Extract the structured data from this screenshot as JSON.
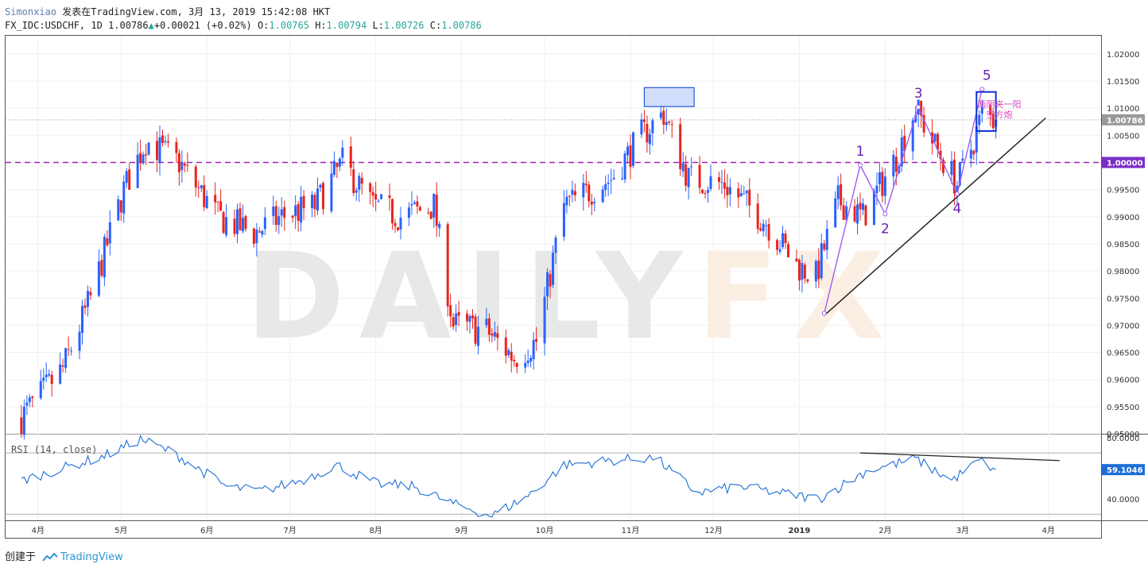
{
  "header": {
    "author": "Simonxiao",
    "published": "发表在TradingView.com, 3月 13, 2019 15:42:08 HKT",
    "symbol": "FX_IDC:USDCHF, 1D",
    "last": "1.00786",
    "change": "+0.00021 (+0.02%)",
    "o_label": "O:",
    "o": "1.00765",
    "h_label": "H:",
    "h": "1.00794",
    "l_label": "L:",
    "l": "1.00726",
    "c_label": "C:",
    "c": "1.00786"
  },
  "footer": {
    "created_by": "创建于",
    "brand": "TradingView"
  },
  "colors": {
    "up": "#2962ff",
    "down": "#e8251d",
    "dashed": "#9c27b0",
    "wave": "#a05cf0",
    "accent": "#26a69a"
  },
  "watermark": "DAILYFX",
  "chart_data": [
    {
      "type": "candlestick",
      "title": "FX_IDC:USDCHF, 1D",
      "x_tick_labels": [
        "4月",
        "5月",
        "6月",
        "7月",
        "8月",
        "9月",
        "10月",
        "11月",
        "12月",
        "2019",
        "2月",
        "3月",
        "4月"
      ],
      "y_tick_labels": [
        "1.02000",
        "1.01500",
        "1.01000",
        "1.00500",
        "1.00000",
        "0.99500",
        "0.99000",
        "0.98500",
        "0.98000",
        "0.97500",
        "0.97000",
        "0.96500",
        "0.96000",
        "0.95500",
        "0.95000"
      ],
      "ylim": [
        0.95,
        1.0235
      ],
      "price_label": "1.00786",
      "level_label": "1.00000",
      "dashed_level": 1.0,
      "waypoints": [
        {
          "t": "2018-03-26",
          "v": 0.953
        },
        {
          "t": "2018-04-10",
          "v": 0.962
        },
        {
          "t": "2018-04-20",
          "v": 0.975
        },
        {
          "t": "2018-05-02",
          "v": 0.995
        },
        {
          "t": "2018-05-10",
          "v": 1.004
        },
        {
          "t": "2018-05-22",
          "v": 1.0
        },
        {
          "t": "2018-06-05",
          "v": 0.99
        },
        {
          "t": "2018-06-18",
          "v": 0.987
        },
        {
          "t": "2018-06-28",
          "v": 0.99
        },
        {
          "t": "2018-07-10",
          "v": 0.992
        },
        {
          "t": "2018-07-20",
          "v": 1.0
        },
        {
          "t": "2018-07-31",
          "v": 0.992
        },
        {
          "t": "2018-08-10",
          "v": 0.99
        },
        {
          "t": "2018-08-22",
          "v": 0.992
        },
        {
          "t": "2018-08-29",
          "v": 0.97
        },
        {
          "t": "2018-09-10",
          "v": 0.969
        },
        {
          "t": "2018-09-20",
          "v": 0.964
        },
        {
          "t": "2018-09-28",
          "v": 0.967
        },
        {
          "t": "2018-10-08",
          "v": 0.992
        },
        {
          "t": "2018-10-25",
          "v": 0.997
        },
        {
          "t": "2018-11-05",
          "v": 1.005
        },
        {
          "t": "2018-11-13",
          "v": 1.009
        },
        {
          "t": "2018-11-22",
          "v": 0.997
        },
        {
          "t": "2018-12-05",
          "v": 0.996
        },
        {
          "t": "2018-12-20",
          "v": 0.989
        },
        {
          "t": "2018-12-31",
          "v": 0.981
        },
        {
          "t": "2019-01-07",
          "v": 0.979
        },
        {
          "t": "2019-01-15",
          "v": 0.993
        },
        {
          "t": "2019-01-24",
          "v": 0.99
        },
        {
          "t": "2019-02-05",
          "v": 1.001
        },
        {
          "t": "2019-02-12",
          "v": 1.01
        },
        {
          "t": "2019-02-19",
          "v": 1.003
        },
        {
          "t": "2019-02-27",
          "v": 0.996
        },
        {
          "t": "2019-03-05",
          "v": 1.004
        },
        {
          "t": "2019-03-08",
          "v": 1.009
        },
        {
          "t": "2019-03-13",
          "v": 1.00786
        }
      ],
      "annotations": {
        "wave_points": [
          {
            "label": "",
            "t": "2019-01-10",
            "v": 0.9722
          },
          {
            "label": "1",
            "t": "2019-01-23",
            "v": 0.9995
          },
          {
            "label": "2",
            "t": "2019-02-01",
            "v": 0.9905
          },
          {
            "label": "3",
            "t": "2019-02-13",
            "v": 1.0102
          },
          {
            "label": "4",
            "t": "2019-02-27",
            "v": 0.9942
          },
          {
            "label": "5",
            "t": "2019-03-08",
            "v": 1.0135
          }
        ],
        "trendline": [
          {
            "t": "2019-01-10",
            "v": 0.9718
          },
          {
            "t": "2019-03-31",
            "v": 1.0082
          }
        ],
        "box_top": [
          {
            "t": "2018-11-06",
            "v": 1.0138
          },
          {
            "t": "2018-11-24",
            "v": 1.0103
          }
        ],
        "box_signal": [
          {
            "t": "2019-03-06",
            "v": 1.013
          },
          {
            "t": "2019-03-13",
            "v": 1.0058
          }
        ],
        "signal_text_1": "两阴夹一阳",
        "signal_text_2": "空方炮"
      }
    },
    {
      "type": "line",
      "title": "RSI (14, close)",
      "y_tick_labels": [
        "80.0000",
        "40.0000"
      ],
      "ylim": [
        26,
        82
      ],
      "upper_band": 70,
      "lower_band": 30,
      "last_label": "59.1046",
      "waypoints": [
        {
          "t": "2018-03-26",
          "v": 52
        },
        {
          "t": "2018-04-10",
          "v": 60
        },
        {
          "t": "2018-04-25",
          "v": 68
        },
        {
          "t": "2018-05-08",
          "v": 79
        },
        {
          "t": "2018-05-20",
          "v": 70
        },
        {
          "t": "2018-06-08",
          "v": 48
        },
        {
          "t": "2018-06-20",
          "v": 45
        },
        {
          "t": "2018-07-05",
          "v": 52
        },
        {
          "t": "2018-07-18",
          "v": 62
        },
        {
          "t": "2018-08-01",
          "v": 50
        },
        {
          "t": "2018-08-15",
          "v": 48
        },
        {
          "t": "2018-08-30",
          "v": 36
        },
        {
          "t": "2018-09-12",
          "v": 29
        },
        {
          "t": "2018-09-25",
          "v": 42
        },
        {
          "t": "2018-10-08",
          "v": 62
        },
        {
          "t": "2018-10-25",
          "v": 65
        },
        {
          "t": "2018-11-10",
          "v": 67
        },
        {
          "t": "2018-11-25",
          "v": 44
        },
        {
          "t": "2018-12-10",
          "v": 48
        },
        {
          "t": "2018-12-25",
          "v": 44
        },
        {
          "t": "2019-01-08",
          "v": 40
        },
        {
          "t": "2019-01-25",
          "v": 58
        },
        {
          "t": "2019-02-12",
          "v": 66
        },
        {
          "t": "2019-02-25",
          "v": 52
        },
        {
          "t": "2019-03-07",
          "v": 65
        },
        {
          "t": "2019-03-13",
          "v": 59.1046
        }
      ],
      "divergence_line": [
        {
          "t": "2019-01-23",
          "v": 70
        },
        {
          "t": "2019-04-05",
          "v": 65
        }
      ]
    }
  ]
}
